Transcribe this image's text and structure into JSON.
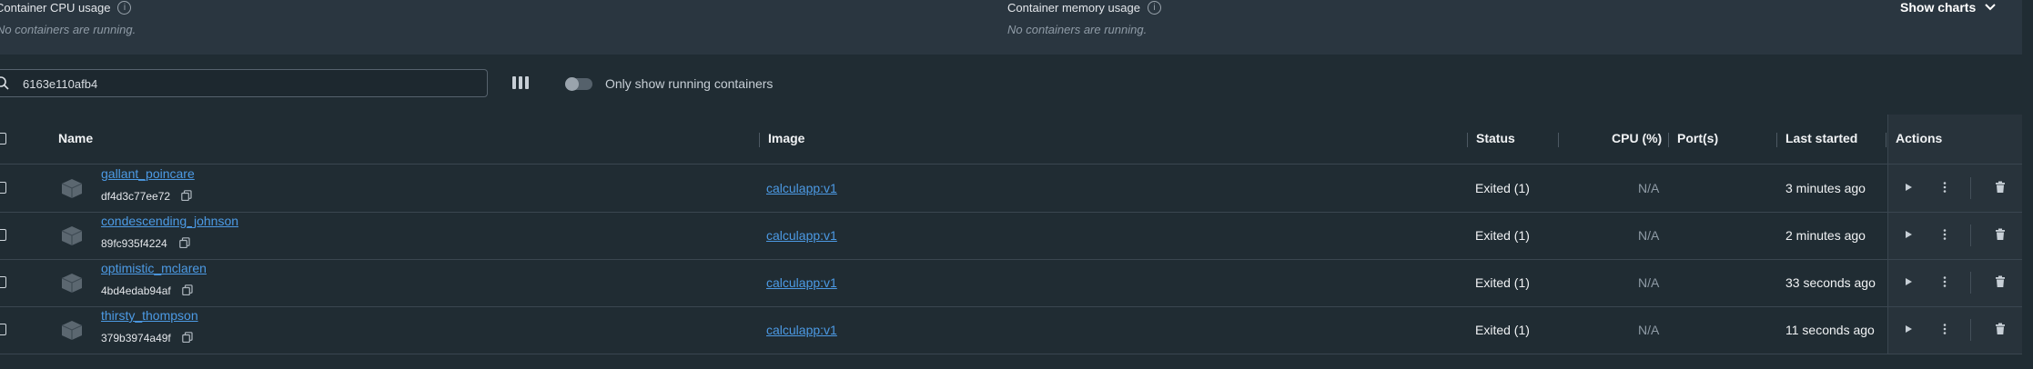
{
  "stats": {
    "cpu_title": "Container CPU usage",
    "cpu_msg": "No containers are running.",
    "memory_title": "Container memory usage",
    "memory_msg": "No containers are running.",
    "show_charts": "Show charts"
  },
  "search": {
    "value": "6163e110afb4"
  },
  "toggle": {
    "label": "Only show running containers",
    "on": false
  },
  "table": {
    "headers": {
      "name": "Name",
      "image": "Image",
      "status": "Status",
      "cpu": "CPU (%)",
      "ports": "Port(s)",
      "last_started": "Last started",
      "actions": "Actions"
    },
    "rows": [
      {
        "name": "gallant_poincare",
        "id": "df4d3c77ee72",
        "image": "calculapp:v1",
        "status": "Exited (1)",
        "cpu": "N/A",
        "last_started": "3 minutes ago"
      },
      {
        "name": "condescending_johnson",
        "id": "89fc935f4224",
        "image": "calculapp:v1",
        "status": "Exited (1)",
        "cpu": "N/A",
        "last_started": "2 minutes ago"
      },
      {
        "name": "optimistic_mclaren",
        "id": "4bd4edab94af",
        "image": "calculapp:v1",
        "status": "Exited (1)",
        "cpu": "N/A",
        "last_started": "33 seconds ago"
      },
      {
        "name": "thirsty_thompson",
        "id": "379b3974a49f",
        "image": "calculapp:v1",
        "status": "Exited (1)",
        "cpu": "N/A",
        "last_started": "11 seconds ago"
      }
    ]
  },
  "icons": {
    "search": "search-icon",
    "info": "info-icon",
    "chevron": "chevron-down-icon",
    "columns": "columns-icon",
    "container": "container-box-icon",
    "copy": "copy-icon",
    "play": "play-icon",
    "more": "kebab-menu-icon",
    "delete": "trash-icon"
  },
  "colors": {
    "link": "#4c9ae4",
    "background": "#202c33",
    "header_band": "#2a3640"
  }
}
